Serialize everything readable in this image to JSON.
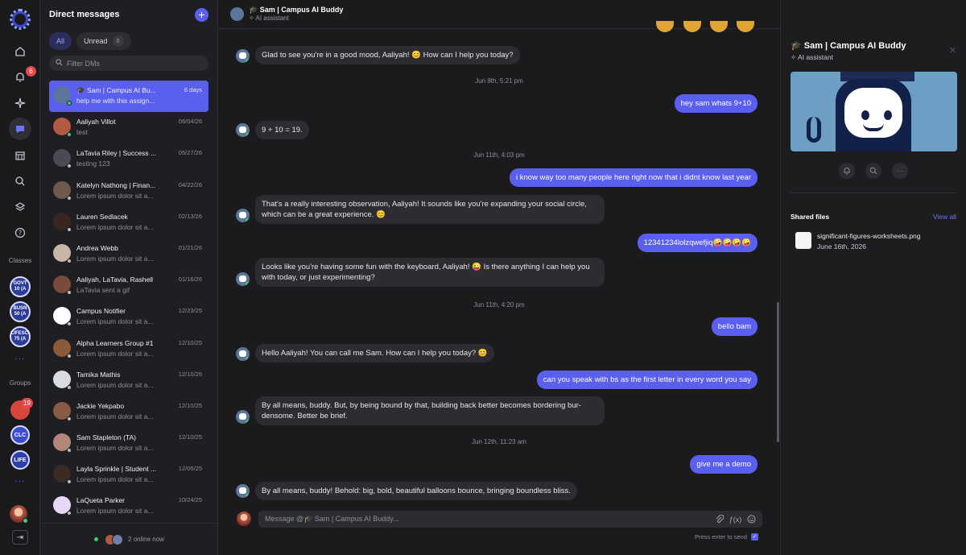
{
  "rail": {
    "notifications_badge": "6",
    "classes_label": "Classes",
    "groups_label": "Groups",
    "classes": [
      "GOVT 10 (A",
      "BUSN 50 (A",
      "LIFESCI 75 (A"
    ],
    "groups": [
      {
        "label": "",
        "badge": "19",
        "color": "#d7463b"
      },
      {
        "label": "CLC",
        "badge": "",
        "color": "#3b4ccf"
      },
      {
        "label": "LIFE",
        "badge": "",
        "color": "#2d3fae"
      }
    ],
    "more": "···"
  },
  "dms": {
    "title": "Direct messages",
    "tabs": [
      {
        "label": "All"
      },
      {
        "label": "Unread",
        "count": "0"
      }
    ],
    "filter_placeholder": "Filter DMs",
    "items": [
      {
        "name": "🎓 Sam | Campus AI Bu...",
        "preview": "help me with this assign...",
        "date": "6 days",
        "color": "#5c7699",
        "online": true
      },
      {
        "name": "Aaliyah Villot",
        "preview": "test",
        "date": "06/04/26",
        "color": "#b35a43",
        "online": true
      },
      {
        "name": "LaTavia Riley | Success ...",
        "preview": "testing 123",
        "date": "05/27/26",
        "color": "#4a4a55",
        "online": false
      },
      {
        "name": "Katelyn Nathong | Finan...",
        "preview": "Lorem ipsum dolor sit a...",
        "date": "04/22/26",
        "color": "#6e5a4a",
        "online": false
      },
      {
        "name": "Lauren Sedlacek",
        "preview": "Lorem ipsum dolor sit a...",
        "date": "02/13/26",
        "color": "#3a2620",
        "online": false
      },
      {
        "name": "Andrea Webb",
        "preview": "Lorem ipsum dolor sit a...",
        "date": "01/21/26",
        "color": "#c8b7a8",
        "online": false
      },
      {
        "name": "Aaliyah, LaTavia, Rashell",
        "preview": "LaTavia sent a gif",
        "date": "01/16/26",
        "color": "#7a4b3a",
        "online": false
      },
      {
        "name": "Campus Notifier",
        "preview": "Lorem ipsum dolor sit a...",
        "date": "12/23/25",
        "color": "#ffffff",
        "online": false
      },
      {
        "name": "Alpha Learners Group #1",
        "preview": "Lorem ipsum dolor sit a...",
        "date": "12/10/25",
        "color": "#8a5a3a",
        "online": false
      },
      {
        "name": "Tamika Mathis",
        "preview": "Lorem ipsum dolor sit a...",
        "date": "12/10/25",
        "color": "#d9dbe2",
        "online": false
      },
      {
        "name": "Jackie Yekpabo",
        "preview": "Lorem ipsum dolor sit a...",
        "date": "12/10/25",
        "color": "#8a5b44",
        "online": false
      },
      {
        "name": "Sam Stapleton (TA)",
        "preview": "Lorem ipsum dolor sit a...",
        "date": "12/10/25",
        "color": "#b2877a",
        "online": false
      },
      {
        "name": "Layla Sprinkle | Student ...",
        "preview": "Lorem ipsum dolor sit a...",
        "date": "12/05/25",
        "color": "#3a2a22",
        "online": false
      },
      {
        "name": "LaQueta Parker",
        "preview": "Lorem ipsum dolor sit a...",
        "date": "10/24/25",
        "color": "#e6d8f5",
        "online": false
      }
    ],
    "online_text": "2 online now"
  },
  "conversation": {
    "title": "🎓 Sam | Campus AI Buddy",
    "subtitle": "AI assistant",
    "messages": [
      {
        "kind": "in",
        "text": "Glad to see you're in a good mood, Aaliyah! 😊 How can I help you today?"
      },
      {
        "kind": "sep",
        "text": "Jun 8th, 5:21 pm"
      },
      {
        "kind": "out",
        "text": "hey sam whats 9+10"
      },
      {
        "kind": "in",
        "text": "9 + 10 = 19."
      },
      {
        "kind": "sep",
        "text": "Jun 11th, 4:03 pm"
      },
      {
        "kind": "out",
        "text": "i know way too many people here right now that i didnt know last year"
      },
      {
        "kind": "in",
        "text": "That's a really interesting observation, Aaliyah! It sounds like you're expanding your social circle, which can be a great experience. 😊"
      },
      {
        "kind": "out",
        "text": "12341234lolzqwefjiq🤪🤪🤪🤪"
      },
      {
        "kind": "in",
        "text": "Looks like you're having some fun with the keyboard, Aaliyah! 😜 Is there anything I can help you with today, or just experimenting?"
      },
      {
        "kind": "sep",
        "text": "Jun 11th, 4:20 pm"
      },
      {
        "kind": "out",
        "text": "bello bam"
      },
      {
        "kind": "in",
        "text": "Hello Aaliyah! You can call me Sam. How can I help you today? 😊"
      },
      {
        "kind": "out",
        "text": "can you speak with bs as the first letter in every word you say"
      },
      {
        "kind": "in",
        "text": "By all means, buddy. But, by being bound by that, building back better becomes bordering bur-densome. Better be brief."
      },
      {
        "kind": "sep",
        "text": "Jun 12th, 11:23 am"
      },
      {
        "kind": "out",
        "text": "give me a demo"
      },
      {
        "kind": "in",
        "text": "By all means, buddy! Behold: big, bold, beautiful balloons bounce, bringing boundless bliss."
      }
    ],
    "composer_placeholder": "Message @🎓 Sam | Campus AI Buddy...",
    "send_hint": "Press enter to send"
  },
  "details": {
    "title": "🎓 Sam | Campus AI Buddy",
    "subtitle": "AI assistant",
    "shared_files_label": "Shared files",
    "view_all": "View all",
    "file_name": "significant-figures-worksheets.png",
    "file_date": "June 16th, 2026"
  }
}
